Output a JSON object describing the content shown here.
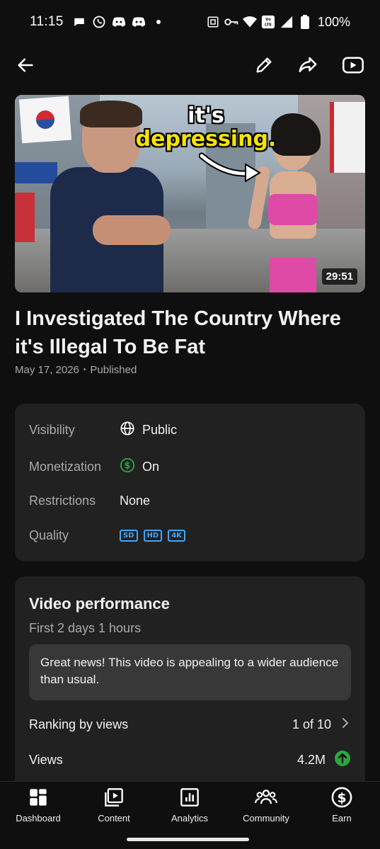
{
  "status_bar": {
    "time": "11:15",
    "battery": "100%",
    "network_badge": "LTE"
  },
  "app_bar": {
    "back_icon": "arrow-left-icon",
    "edit_icon": "pencil-icon",
    "share_icon": "share-icon",
    "watch_icon": "youtube-play-icon"
  },
  "thumbnail": {
    "overlay_line1": "it's",
    "overlay_line2": "depressing.",
    "duration": "29:51"
  },
  "video": {
    "title": "I Investigated The Country Where it's Illegal To Be Fat",
    "date": "May 17, 2026",
    "separator": "•",
    "status": "Published"
  },
  "details": {
    "visibility_label": "Visibility",
    "visibility_value": "Public",
    "monetization_label": "Monetization",
    "monetization_value": "On",
    "restrictions_label": "Restrictions",
    "restrictions_value": "None",
    "quality_label": "Quality",
    "quality_badges": [
      "SD",
      "HD",
      "4K"
    ],
    "accent_color": "#3ea6ff",
    "monetization_color": "#2ba640"
  },
  "performance": {
    "heading": "Video performance",
    "period": "First 2 days 1 hours",
    "note": "Great news! This video is appealing to a wider audience than usual.",
    "ranking_label": "Ranking by views",
    "ranking_value": "1 of 10",
    "views_label": "Views",
    "views_value": "4.2M",
    "trend_color": "#2ba640"
  },
  "bottom_nav": {
    "items": [
      {
        "label": "Dashboard",
        "icon": "dashboard-icon"
      },
      {
        "label": "Content",
        "icon": "content-icon"
      },
      {
        "label": "Analytics",
        "icon": "analytics-icon"
      },
      {
        "label": "Community",
        "icon": "community-icon"
      },
      {
        "label": "Earn",
        "icon": "earn-icon"
      }
    ]
  }
}
